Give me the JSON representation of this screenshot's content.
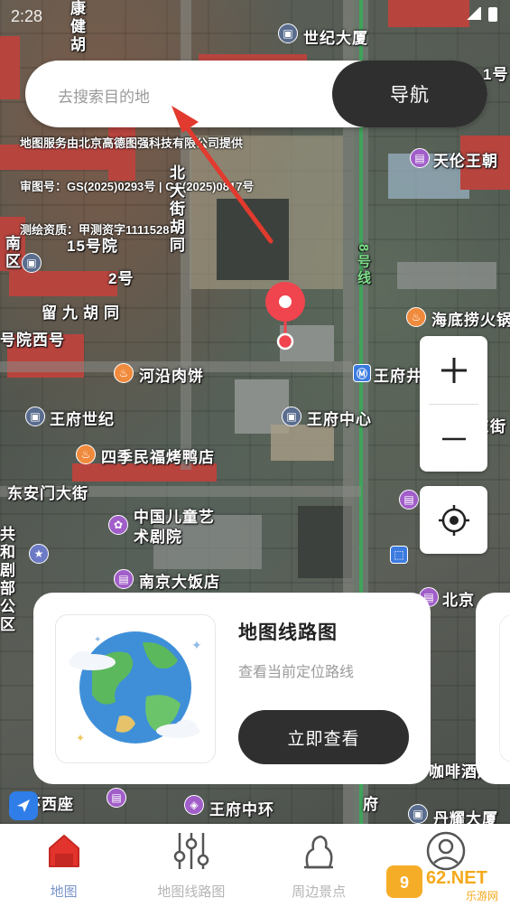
{
  "status_bar": {
    "time": "2:28"
  },
  "search": {
    "placeholder": "去搜索目的地",
    "nav_label": "导航"
  },
  "map": {
    "copyright_lines": [
      "地图服务由北京高德图强科技有限公司提供",
      "审图号：GS(2025)0293号 | GS(2025)0817号",
      "测绘资质：甲测资字1111528"
    ],
    "labels": {
      "kangjian": "康健胡",
      "shiji": "世纪大厦",
      "tianlun": "天伦王朝",
      "beidaji": "北大街胡同",
      "n15": "15号院",
      "n2": "2号",
      "n1": "1号",
      "liujiu": "留九胡同",
      "yuanxi": "号院西号",
      "haidilao": "海底捞火锅",
      "heyan": "河沿肉饼",
      "wangfujing_center": "王府中心",
      "wangfu_shiji": "王府世纪",
      "siji": "四季民福烤鸭店",
      "dongan": "东安门大街",
      "ertong": "中国儿童艺术剧院",
      "nanjing": "南京大饭店",
      "wangfuzhonghuan": "王府中环",
      "danyao": "丹耀大厦",
      "beijing": "北京",
      "line8": "8号线",
      "wangfujing_st": "王府井",
      "dong": "东街",
      "gongheju": "共和剧部公区",
      "nan": "南区",
      "cafe": "咖啡酒店",
      "zhonghuan_west": "中环西座",
      "daxing": "府"
    }
  },
  "controls": {
    "zoom_in": "+",
    "zoom_out": "−"
  },
  "card": {
    "title": "地图线路图",
    "subtitle": "查看当前定位路线",
    "button": "立即查看"
  },
  "bottom_nav": [
    {
      "label": "地图",
      "icon": "home-icon",
      "active": true
    },
    {
      "label": "地图线路图",
      "icon": "sliders-icon",
      "active": false
    },
    {
      "label": "周边景点",
      "icon": "landmark-icon",
      "active": false
    },
    {
      "label": "",
      "icon": "profile-icon",
      "active": false
    }
  ],
  "watermark": {
    "text": "962.NET",
    "sub": "乐游网"
  },
  "colors": {
    "accent": "#2f2f2f",
    "pin": "#f0444e",
    "active_tab": "#7a94c9"
  }
}
